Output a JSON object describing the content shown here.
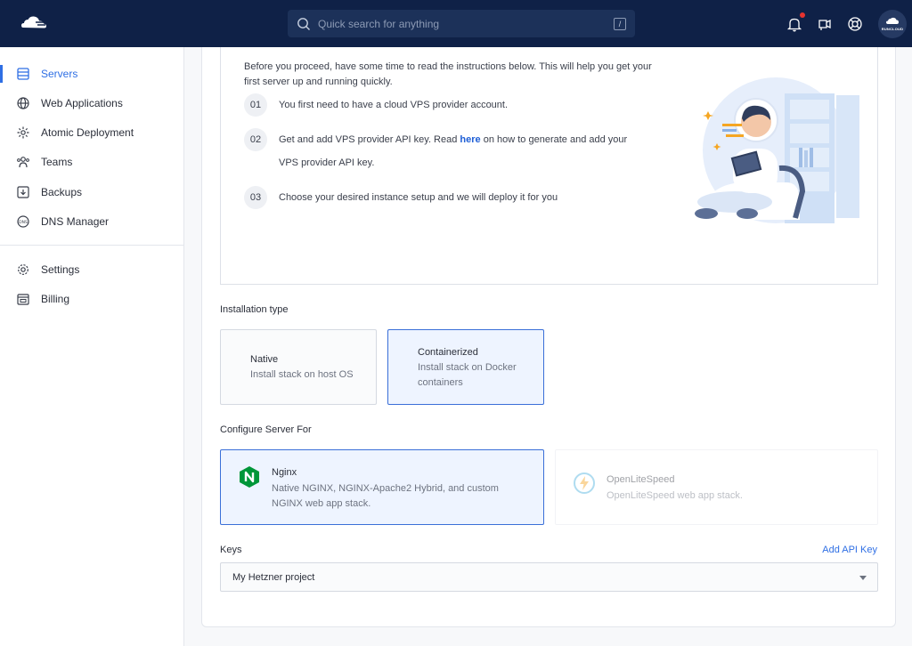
{
  "header": {
    "search_placeholder": "Quick search for anything",
    "search_shortcut": "/",
    "avatar_text": "RUNCLOUD"
  },
  "sidebar": {
    "items": [
      {
        "label": "Servers",
        "icon": "servers-icon",
        "active": true
      },
      {
        "label": "Web Applications",
        "icon": "globe-icon"
      },
      {
        "label": "Atomic Deployment",
        "icon": "atom-icon"
      },
      {
        "label": "Teams",
        "icon": "teams-icon"
      },
      {
        "label": "Backups",
        "icon": "backup-icon"
      },
      {
        "label": "DNS Manager",
        "icon": "dns-icon"
      },
      {
        "label": "Settings",
        "icon": "gear-icon"
      },
      {
        "label": "Billing",
        "icon": "billing-icon"
      }
    ]
  },
  "intro": {
    "text": "Before you proceed, have some time to read the instructions below. This will help you get your first server up and running quickly.",
    "steps": [
      {
        "num": "01",
        "text": "You first need to have a cloud VPS provider account."
      },
      {
        "num": "02",
        "text_before": "Get and add VPS provider API key. Read ",
        "link": "here",
        "text_after": " on how to generate and add your VPS provider API key."
      },
      {
        "num": "03",
        "text": "Choose your desired instance setup and we will deploy it for you"
      }
    ]
  },
  "installation": {
    "label": "Installation type",
    "options": [
      {
        "title": "Native",
        "desc": "Install stack on host OS",
        "selected": false
      },
      {
        "title": "Containerized",
        "desc": "Install stack on Docker containers",
        "selected": true
      }
    ]
  },
  "configure": {
    "label": "Configure Server For",
    "options": [
      {
        "title": "Nginx",
        "desc": "Native NGINX, NGINX-Apache2 Hybrid, and custom NGINX web app stack.",
        "selected": true,
        "icon": "nginx-icon"
      },
      {
        "title": "OpenLiteSpeed",
        "desc": "OpenLiteSpeed web app stack.",
        "selected": false,
        "disabled": true,
        "icon": "litespeed-icon"
      }
    ]
  },
  "keys": {
    "label": "Keys",
    "add_link": "Add API Key",
    "selected": "My Hetzner project"
  },
  "colors": {
    "header_bg": "#0f2147",
    "accent": "#2f6fe4",
    "selected_bg": "#eef4ff",
    "nginx_green": "#009639"
  }
}
